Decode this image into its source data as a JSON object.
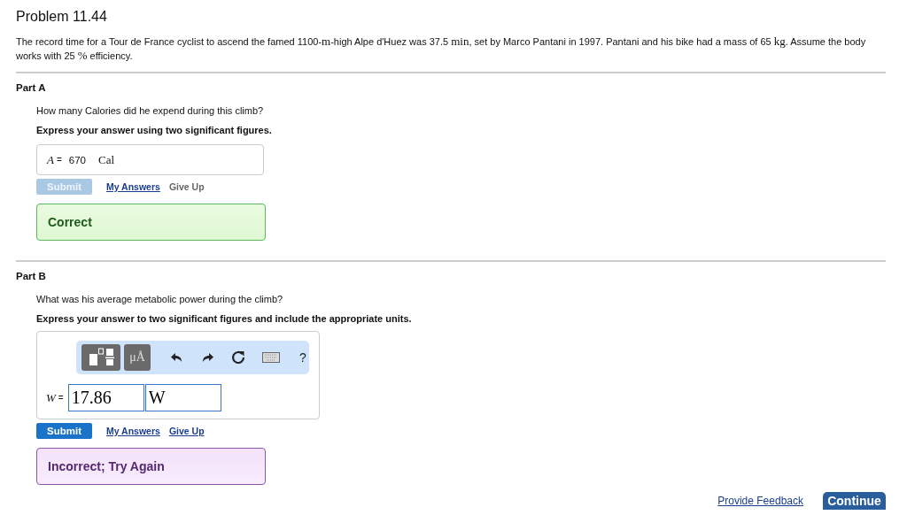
{
  "title": "Problem 11.44",
  "intro": [
    {
      "kind": "text",
      "text": "The record time for a Tour de France cyclist to ascend the famed 1100-"
    },
    {
      "kind": "unit",
      "text": "m"
    },
    {
      "kind": "text",
      "text": "-high Alpe d'Huez was 37.5 "
    },
    {
      "kind": "unit",
      "text": "min"
    },
    {
      "kind": "text",
      "text": ", set by Marco Pantani in 1997. Pantani and his bike had a mass of 65 "
    },
    {
      "kind": "unit",
      "text": "kg"
    },
    {
      "kind": "text",
      "text": ". Assume the body works with 25 "
    },
    {
      "kind": "unit",
      "text": "%"
    },
    {
      "kind": "text",
      "text": " efficiency."
    }
  ],
  "parts": [
    {
      "label": "Part A",
      "question": "How many Calories did he expend during this climb?",
      "instruction": "Express your answer using two significant figures.",
      "answer": {
        "kind": "static",
        "variable": "A",
        "equals": "=",
        "value": "670",
        "unit": "Cal"
      },
      "submit": {
        "label": "Submit",
        "disabled": true
      },
      "my_answers": "My Answers",
      "give_up": {
        "label": "Give Up",
        "disabled": true
      },
      "feedback": {
        "kind": "correct",
        "text": "Correct"
      }
    },
    {
      "label": "Part B",
      "question": "What was his average metabolic power during the climb?",
      "instruction": "Express your answer to two significant figures and include the appropriate units.",
      "answer": {
        "kind": "editor",
        "variable": "W",
        "equals": "=",
        "value": "17.86",
        "unit": "W",
        "toolbar": {
          "units_label": "μÅ",
          "help": "?"
        }
      },
      "submit": {
        "label": "Submit",
        "disabled": false
      },
      "my_answers": "My Answers",
      "give_up": {
        "label": "Give Up",
        "disabled": false
      },
      "feedback": {
        "kind": "incorrect",
        "text": "Incorrect; Try Again"
      }
    }
  ],
  "footer": {
    "feedback_link": "Provide Feedback",
    "continue": "Continue"
  }
}
